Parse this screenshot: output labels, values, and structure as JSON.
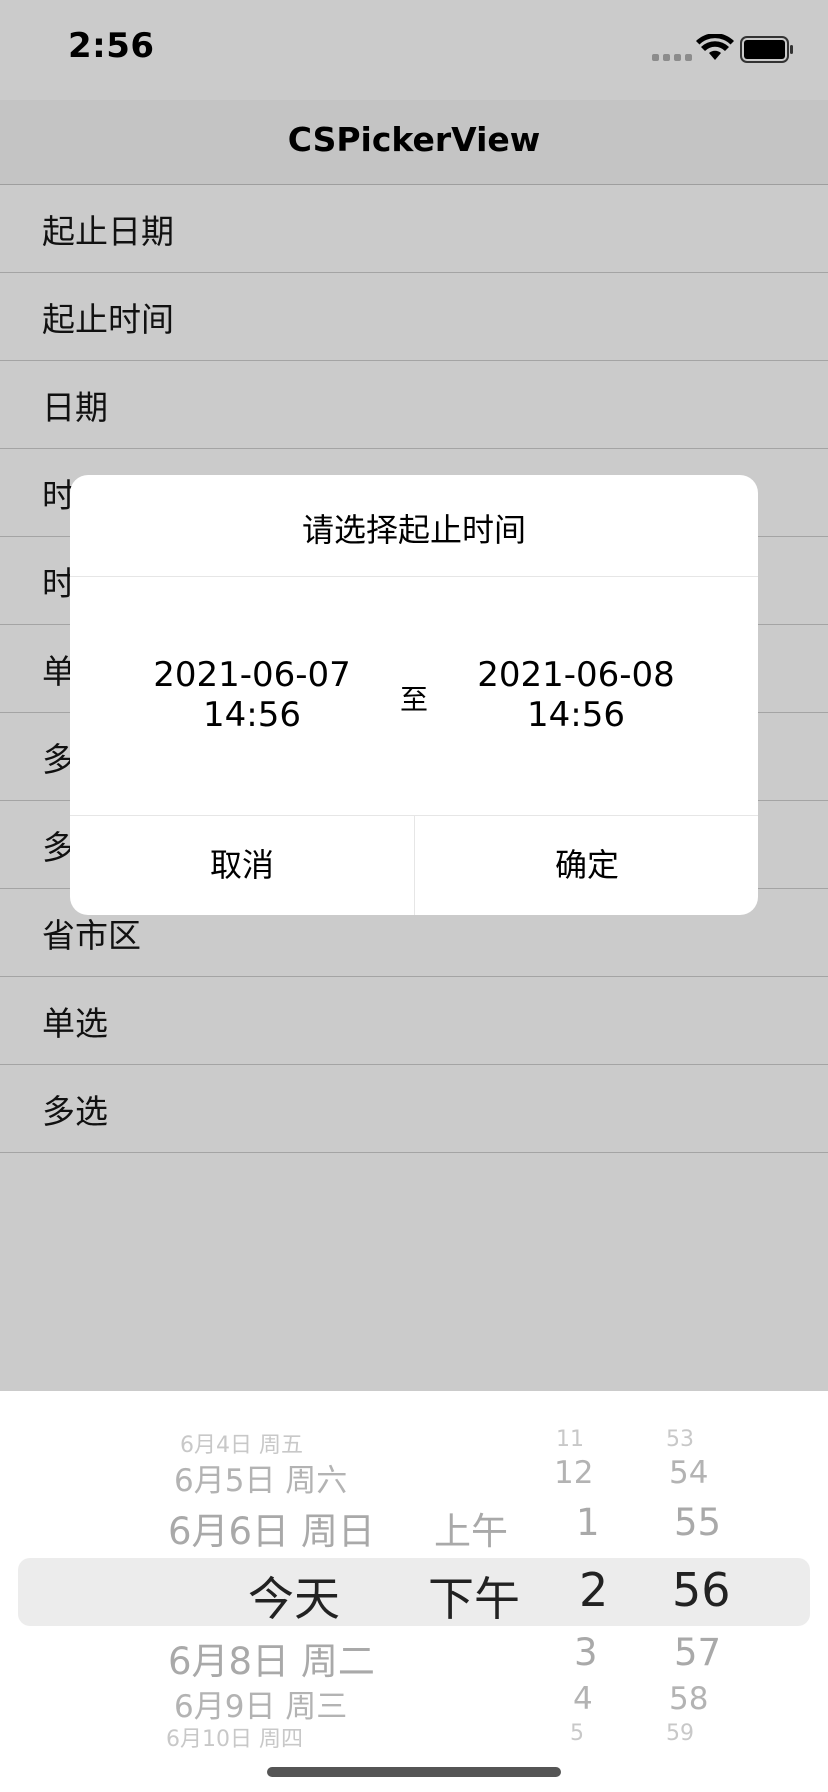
{
  "status_bar": {
    "time": "2:56"
  },
  "navbar": {
    "title": "CSPickerView"
  },
  "list_items": [
    "起止日期",
    "起止时间",
    "日期",
    "时",
    "时",
    "单",
    "多",
    "多",
    "省市区",
    "单选",
    "多选"
  ],
  "dialog": {
    "title": "请选择起止时间",
    "start_date": "2021-06-07",
    "start_time": "14:56",
    "to_label": "至",
    "end_date": "2021-06-08",
    "end_time": "14:56",
    "cancel_label": "取消",
    "confirm_label": "确定"
  },
  "picker": {
    "days": [
      "6月4日 周五",
      "6月5日 周六",
      "6月6日 周日",
      "今天",
      "6月8日 周二",
      "6月9日 周三",
      "6月10日 周四"
    ],
    "ampm": [
      "上午",
      "下午"
    ],
    "hours": [
      "11",
      "12",
      "1",
      "2",
      "3",
      "4",
      "5"
    ],
    "minutes": [
      "53",
      "54",
      "55",
      "56",
      "57",
      "58",
      "59"
    ],
    "selected": {
      "day": "今天",
      "ampm": "下午",
      "hour": "2",
      "minute": "56"
    }
  },
  "icons": [
    "signal-icon",
    "wifi-icon",
    "battery-icon"
  ]
}
